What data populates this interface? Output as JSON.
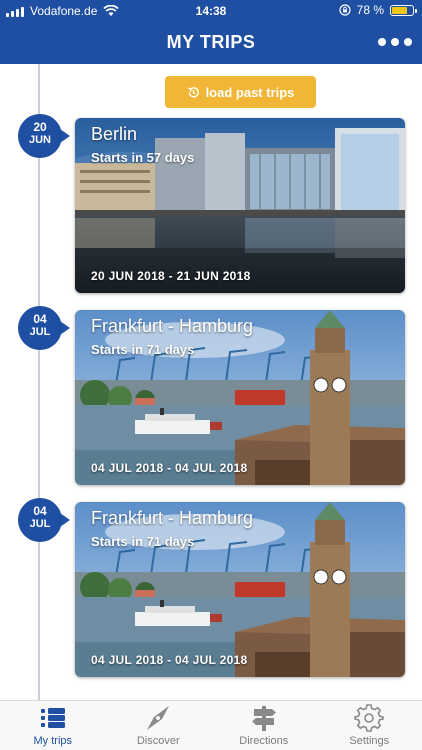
{
  "status_bar": {
    "carrier": "Vodafone.de",
    "time": "14:38",
    "battery": "78 %",
    "battery_level": 0.78,
    "signal_icon": "signal-bars-icon",
    "wifi_icon": "wifi-icon",
    "lock_icon": "orientation-lock-icon"
  },
  "header": {
    "title": "MY TRIPS",
    "more_icon": "more-dots-icon"
  },
  "load_past_trips": {
    "label": "load past trips",
    "icon": "history-icon",
    "color": "#f2b636"
  },
  "theme": {
    "primary": "#1f4fa3",
    "accent": "#f2b636"
  },
  "trips": [
    {
      "day": "20",
      "month": "JUN",
      "title": "Berlin",
      "starts": "Starts in 57 days",
      "dates": "20 JUN 2018 - 21 JUN 2018",
      "image": "berlin-river-buildings"
    },
    {
      "day": "04",
      "month": "JUL",
      "title": "Frankfurt - Hamburg",
      "starts": "Starts in 71 days",
      "dates": "04 JUL 2018 - 04 JUL 2018",
      "image": "hamburg-harbour-clocktower"
    },
    {
      "day": "04",
      "month": "JUL",
      "title": "Frankfurt - Hamburg",
      "starts": "Starts in 71 days",
      "dates": "04 JUL 2018 - 04 JUL 2018",
      "image": "hamburg-harbour-clocktower"
    }
  ],
  "tabs": [
    {
      "label": "My trips",
      "icon": "list-icon",
      "active": true
    },
    {
      "label": "Discover",
      "icon": "compass-icon",
      "active": false
    },
    {
      "label": "Directions",
      "icon": "signpost-icon",
      "active": false
    },
    {
      "label": "Settings",
      "icon": "gear-icon",
      "active": false
    }
  ]
}
